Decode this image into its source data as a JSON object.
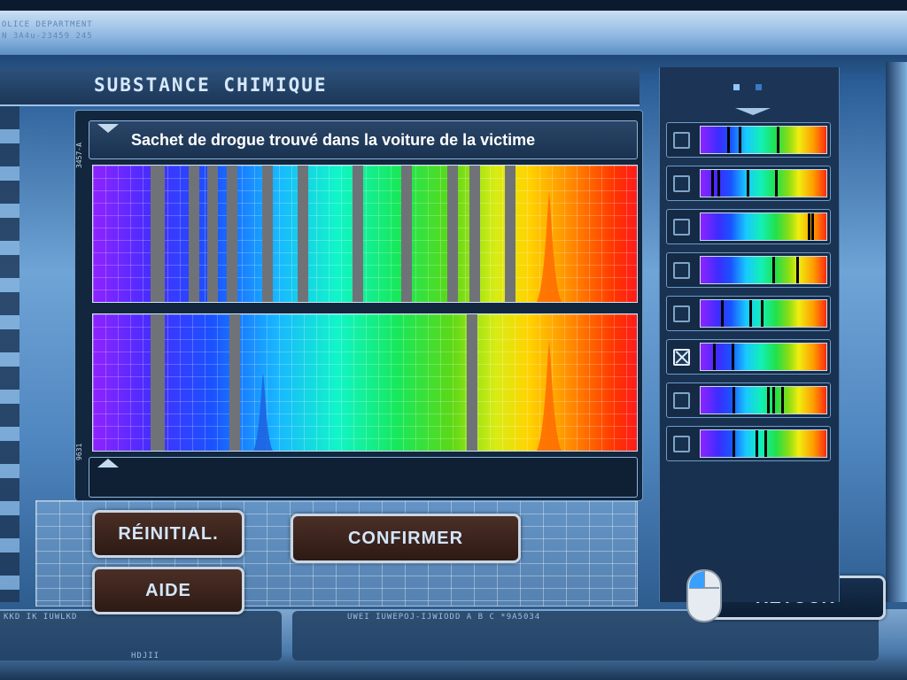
{
  "header": {
    "corner_text": [
      "OLICE DEPARTMENT",
      "N 3A4u-23459 245"
    ],
    "title": "SUBSTANCE CHIMIQUE"
  },
  "analysis": {
    "caption": "Sachet de drogue trouvé dans la voiture de la victime",
    "side_label_top": "3457-A",
    "side_label_bottom": "9631",
    "sample_bands": [
      0.105,
      0.175,
      0.21,
      0.245,
      0.31,
      0.375,
      0.475,
      0.565,
      0.65,
      0.69,
      0.755
    ],
    "reference_bands": [
      0.105,
      0.25,
      0.685
    ]
  },
  "buttons": {
    "reset_label": "RÉINITIAL.",
    "help_label": "AIDE",
    "confirm_label": "CONFIRMER",
    "back_label": "RETOUR"
  },
  "substance_list": {
    "items": [
      {
        "checked": false,
        "lines": [
          0.21,
          0.3,
          0.6
        ]
      },
      {
        "checked": false,
        "lines": [
          0.08,
          0.13,
          0.36,
          0.58
        ]
      },
      {
        "checked": false,
        "lines": [
          0.84,
          0.87
        ]
      },
      {
        "checked": false,
        "lines": [
          0.56,
          0.75
        ]
      },
      {
        "checked": false,
        "lines": [
          0.16,
          0.38,
          0.47
        ]
      },
      {
        "checked": true,
        "lines": [
          0.1,
          0.24
        ]
      },
      {
        "checked": false,
        "lines": [
          0.25,
          0.52,
          0.56,
          0.63
        ]
      },
      {
        "checked": false,
        "lines": [
          0.25,
          0.43,
          0.5
        ]
      }
    ]
  },
  "bottom_bar": {
    "left_text": "KKD IK        IUWLKD",
    "mid_text": "UWEI        IUWEPOJ-IJWIODD     A   B   C   *9A5034",
    "sub_text": "HDJII"
  },
  "colors": {
    "button_fill": "#3b241c",
    "button_border": "#c9d7e6",
    "button_text": "#d3e6fb",
    "band_gray": "#6f7378"
  }
}
